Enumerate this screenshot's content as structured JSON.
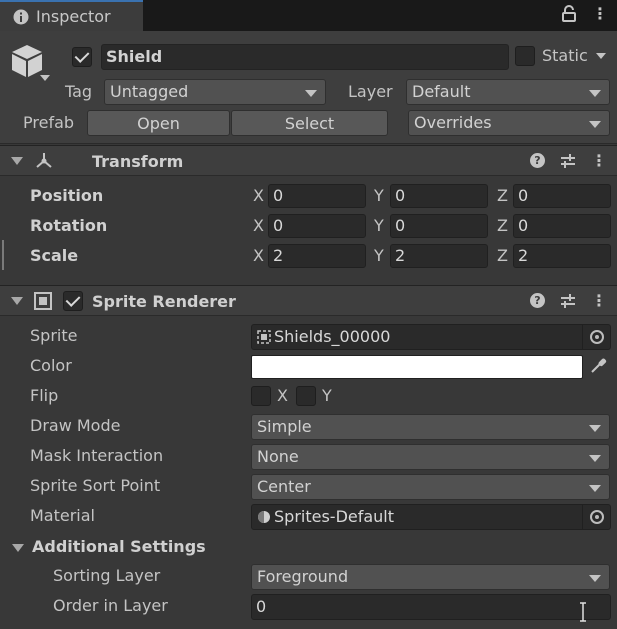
{
  "tab": {
    "title": "Inspector"
  },
  "header": {
    "object_name": "Shield",
    "static_label": "Static",
    "tag_label": "Tag",
    "tag_value": "Untagged",
    "layer_label": "Layer",
    "layer_value": "Default",
    "prefab_label": "Prefab",
    "open_label": "Open",
    "select_label": "Select",
    "overrides_label": "Overrides",
    "active": true
  },
  "transform": {
    "title": "Transform",
    "rows": [
      {
        "label": "Position",
        "x": "0",
        "y": "0",
        "z": "0"
      },
      {
        "label": "Rotation",
        "x": "0",
        "y": "0",
        "z": "0"
      },
      {
        "label": "Scale",
        "x": "2",
        "y": "2",
        "z": "2"
      }
    ],
    "axes": {
      "x": "X",
      "y": "Y",
      "z": "Z"
    }
  },
  "sprite_renderer": {
    "title": "Sprite Renderer",
    "enabled": true,
    "sprite_label": "Sprite",
    "sprite_value": "Shields_00000",
    "color_label": "Color",
    "color_value": "#ffffff",
    "flip_label": "Flip",
    "flip_x": "X",
    "flip_y": "Y",
    "draw_mode_label": "Draw Mode",
    "draw_mode_value": "Simple",
    "mask_label": "Mask Interaction",
    "mask_value": "None",
    "sort_point_label": "Sprite Sort Point",
    "sort_point_value": "Center",
    "material_label": "Material",
    "material_value": "Sprites-Default",
    "additional_label": "Additional Settings",
    "sorting_layer_label": "Sorting Layer",
    "sorting_layer_value": "Foreground",
    "order_label": "Order in Layer",
    "order_value": "0"
  },
  "colors": {
    "accent": "#3a72b0",
    "background": "#383838"
  }
}
